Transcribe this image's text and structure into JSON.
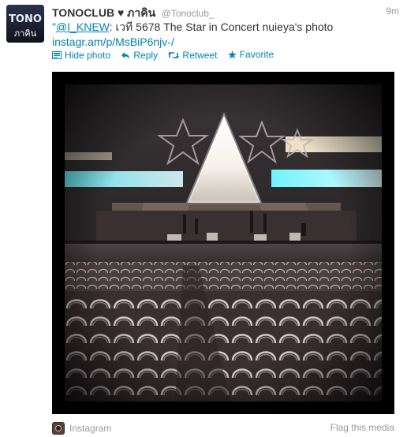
{
  "tweet": {
    "full_name": "TONOCLUB ♥ ภาคิน",
    "screen_name": "@Tonoclub_",
    "time": "9m",
    "quote_open": "\"",
    "mention": "@I_KNEW",
    "text": ": เวที 5678 The Star in Concert nuieya's photo",
    "link": "instagr.am/p/MsBiP6njv-/"
  },
  "avatar": {
    "line1": "TONO",
    "line2": "ภาคิน"
  },
  "actions": {
    "hide_photo": "Hide photo",
    "reply": "Reply",
    "retweet": "Retweet",
    "favorite": "Favorite"
  },
  "media": {
    "source": "Instagram",
    "flag": "Flag this media"
  },
  "colors": {
    "link": "#0084b4",
    "muted": "#999999",
    "frame": "#000000"
  },
  "icons": [
    "photo-icon",
    "reply-icon",
    "retweet-icon",
    "star-icon",
    "instagram-icon"
  ]
}
